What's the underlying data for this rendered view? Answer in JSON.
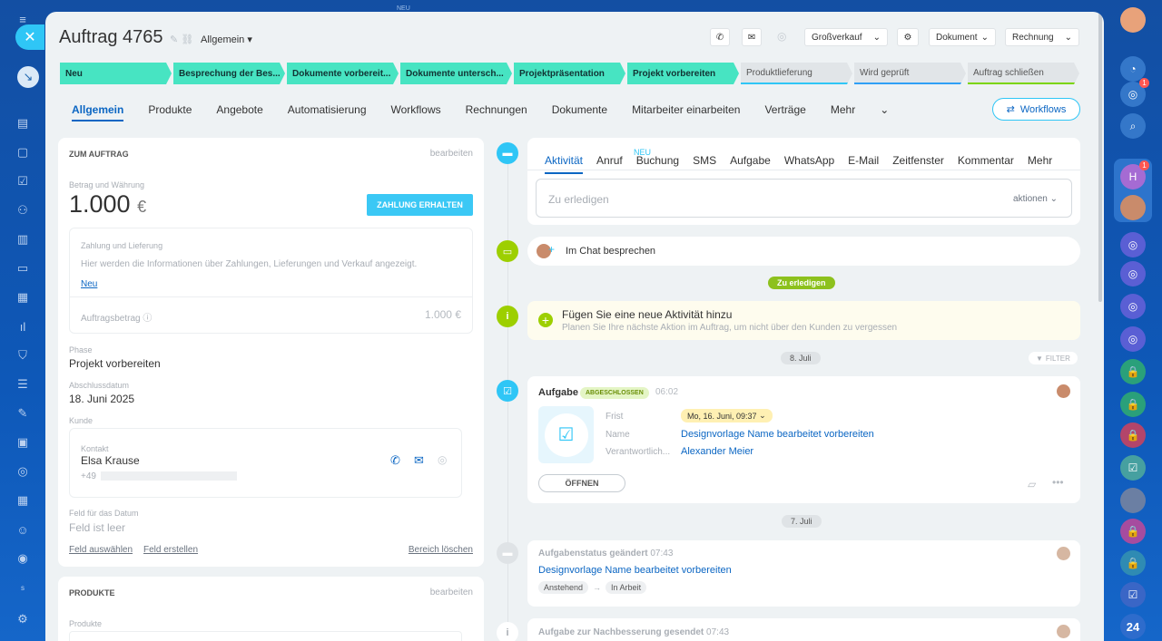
{
  "window": {
    "top_label": "NEU"
  },
  "deal": {
    "title": "Auftrag 4765",
    "subtitle": "Allgemein",
    "toolbar": {
      "grossverkauf": "Großverkauf",
      "dokument": "Dokument",
      "rechnung": "Rechnung"
    }
  },
  "stages": [
    {
      "label": "Neu",
      "done": true
    },
    {
      "label": "Besprechung der Bes...",
      "done": true
    },
    {
      "label": "Dokumente vorbereit...",
      "done": true
    },
    {
      "label": "Dokumente untersch...",
      "done": true
    },
    {
      "label": "Projektpräsentation",
      "done": true
    },
    {
      "label": "Projekt vorbereiten",
      "done": true
    },
    {
      "label": "Produktlieferung",
      "done": false
    },
    {
      "label": "Wird geprüft",
      "done": false
    },
    {
      "label": "Auftrag schließen",
      "done": false
    }
  ],
  "tabs": [
    "Allgemein",
    "Produkte",
    "Angebote",
    "Automatisierung",
    "Workflows",
    "Rechnungen",
    "Dokumente",
    "Mitarbeiter einarbeiten",
    "Verträge",
    "Mehr"
  ],
  "workflows_button": "Workflows",
  "left": {
    "section_title": "ZUM AUFTRAG",
    "edit": "bearbeiten",
    "amount_label": "Betrag und Währung",
    "amount": "1.000",
    "currency": "€",
    "payment_button": "ZAHLUNG ERHALTEN",
    "payment_title": "Zahlung und Lieferung",
    "payment_info": "Hier werden die Informationen über Zahlungen, Lieferungen und Verkauf angezeigt.",
    "payment_new": "Neu",
    "order_amount_label": "Auftragsbetrag",
    "order_amount": "1.000 €",
    "phase_label": "Phase",
    "phase": "Projekt vorbereiten",
    "close_date_label": "Abschlussdatum",
    "close_date": "18. Juni 2025",
    "client_label": "Kunde",
    "contact_label": "Kontakt",
    "contact_name": "Elsa Krause",
    "contact_phone": "+49",
    "date_field_label": "Feld für das Datum",
    "date_field_value": "Feld ist leer",
    "select_field": "Feld auswählen",
    "create_field": "Feld erstellen",
    "clear_area": "Bereich löschen",
    "products_title": "PRODUKTE",
    "products_edit": "bearbeiten",
    "products_label": "Produkte"
  },
  "activity": {
    "tabs": [
      "Aktivität",
      "Anruf",
      "Buchung",
      "SMS",
      "Aufgabe",
      "WhatsApp",
      "E-Mail",
      "Zeitfenster",
      "Kommentar",
      "Mehr"
    ],
    "new_tag": "NEU",
    "todo_placeholder": "Zu erledigen",
    "actions": "aktionen",
    "chat": "Im Chat besprechen",
    "todo_pill": "Zu erledigen",
    "add_title": "Fügen Sie eine neue Aktivität hinzu",
    "add_desc": "Planen Sie Ihre nächste Aktion im Auftrag, um nicht über den Kunden zu vergessen",
    "date1": "8. Juli",
    "filter": "FILTER",
    "task": {
      "title": "Aufgabe",
      "status": "ABGESCHLOSSEN",
      "time": "06:02",
      "deadline_label": "Frist",
      "deadline": "Mo, 16. Juni, 09:37",
      "name_label": "Name",
      "name": "Designvorlage Name bearbeitet vorbereiten",
      "resp_label": "Verantwortlich...",
      "resp": "Alexander Meier",
      "open": "ÖFFNEN"
    },
    "date2": "7. Juli",
    "status_change": {
      "title": "Aufgabenstatus geändert",
      "time": "07:43",
      "link": "Designvorlage Name bearbeitet vorbereiten",
      "from": "Anstehend",
      "to": "In Arbeit"
    },
    "revision": {
      "title": "Aufgabe zur Nachbesserung gesendet",
      "time": "07:43"
    }
  },
  "rail": {
    "bottom_label": "24",
    "avatar_letter": "H",
    "badge": "1"
  }
}
